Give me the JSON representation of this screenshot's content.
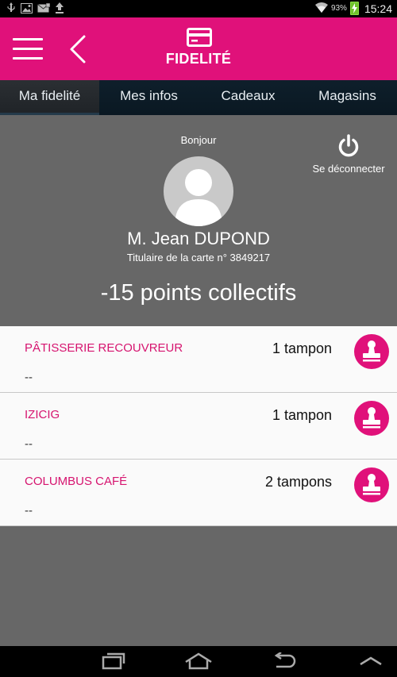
{
  "status_bar": {
    "battery_percent": "93%",
    "time": "15:24",
    "icons": [
      "usb-icon",
      "image-icon",
      "mail-icon",
      "upload-icon",
      "wifi-icon",
      "battery-charging-icon"
    ]
  },
  "app_bar": {
    "title": "FIDELITÉ",
    "menu_icon": "hamburger-menu-icon",
    "back_icon": "chevron-left-icon",
    "title_icon": "credit-card-icon"
  },
  "tabs": [
    {
      "label": "Ma fidelité",
      "active": true
    },
    {
      "label": "Mes infos",
      "active": false
    },
    {
      "label": "Cadeaux",
      "active": false
    },
    {
      "label": "Magasins",
      "active": false
    }
  ],
  "profile": {
    "greeting": "Bonjour",
    "name": "M. Jean DUPOND",
    "card_holder": "Titulaire de la carte n° 3849217",
    "points": "-15 points collectifs",
    "logout_label": "Se déconnecter"
  },
  "shops": [
    {
      "name": "PÂTISSERIE RECOUVREUR",
      "stamps": "1 tampon",
      "sub": "--"
    },
    {
      "name": "IZICIG",
      "stamps": "1 tampon",
      "sub": "--"
    },
    {
      "name": "COLUMBUS CAFÉ",
      "stamps": "2 tampons",
      "sub": "--"
    }
  ],
  "colors": {
    "brand": "#e0117a",
    "tab_bar": "#0e1f2b",
    "profile_bg": "#676767"
  }
}
